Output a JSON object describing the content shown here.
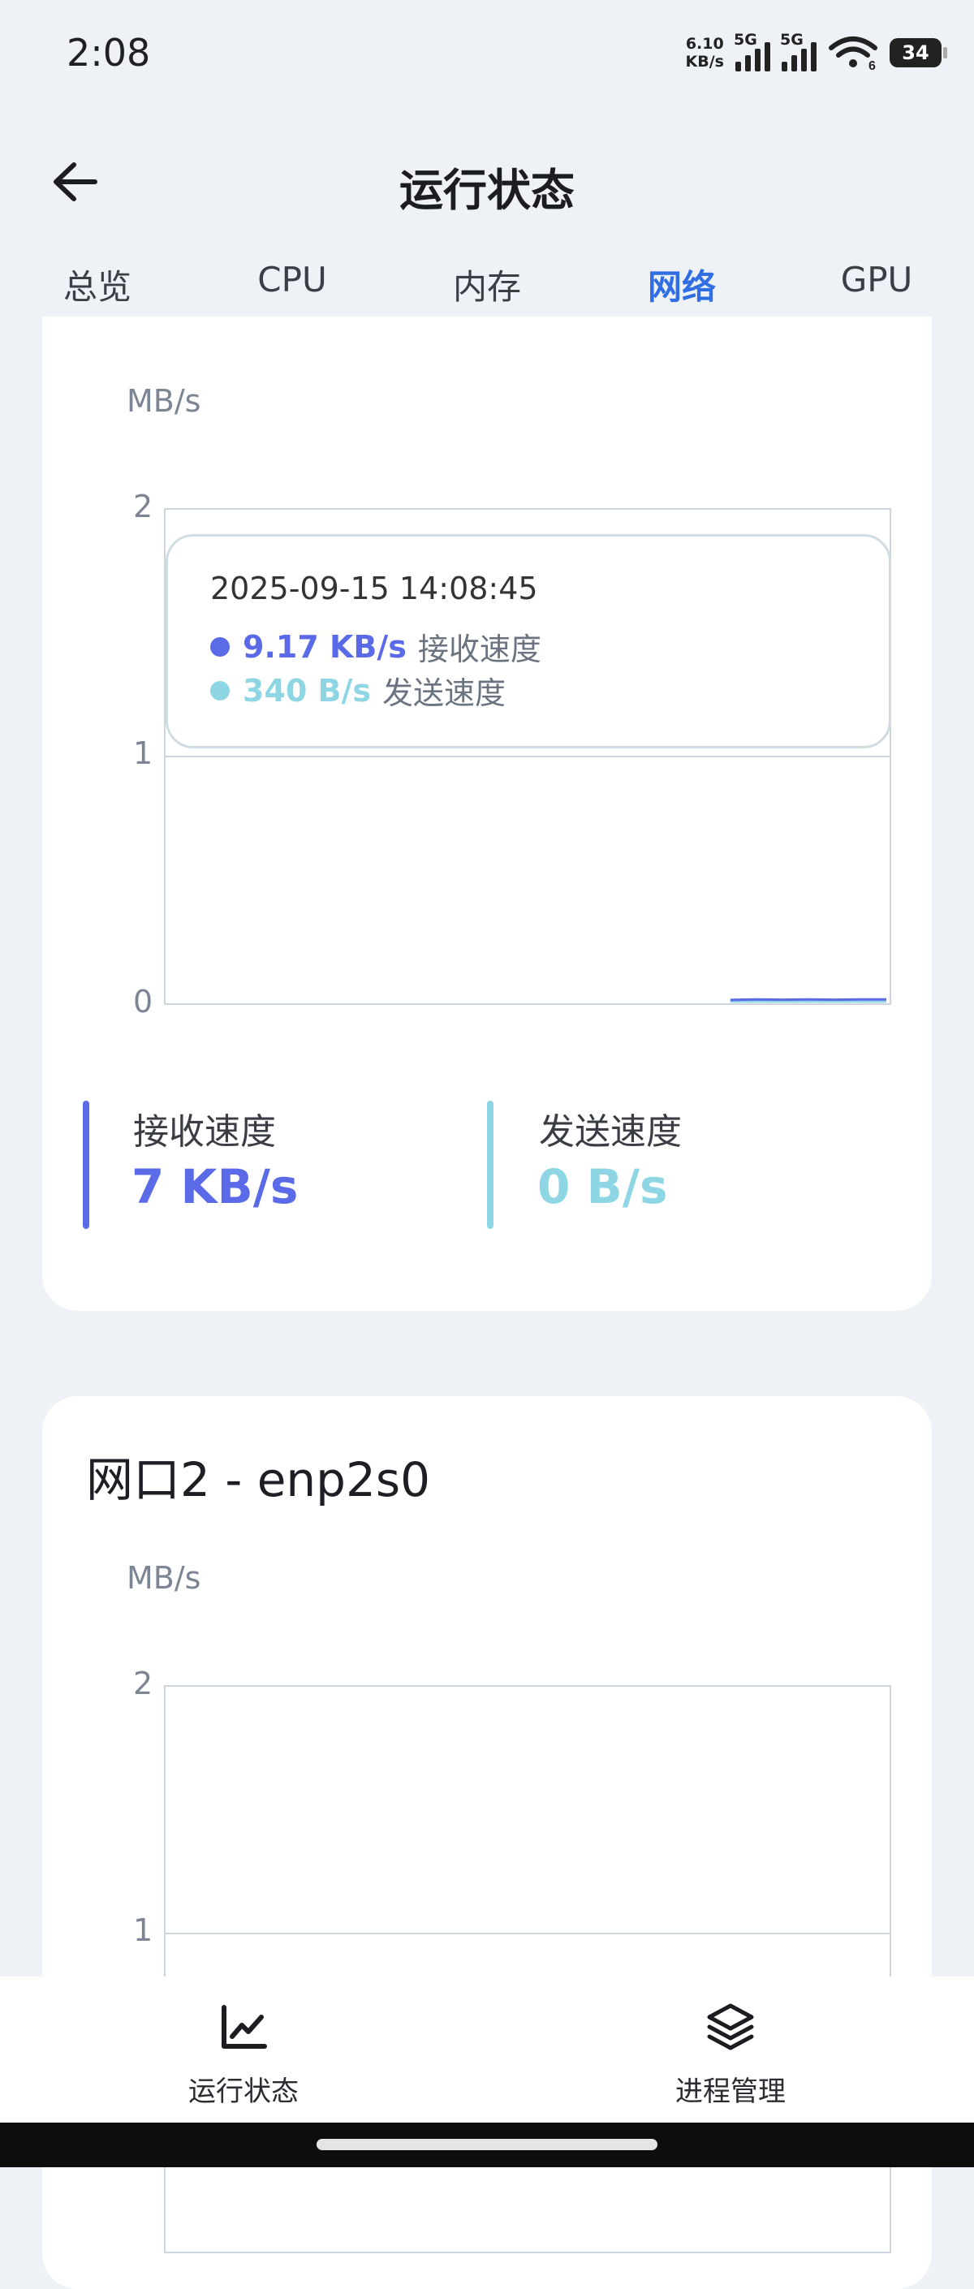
{
  "status_bar": {
    "time": "2:08",
    "net_speed_value": "6.10",
    "net_speed_unit": "KB/s",
    "sim1": "5G",
    "sim2": "5G",
    "wifi_badge": "6",
    "battery": "34"
  },
  "header": {
    "title": "运行状态",
    "back_icon": "arrow-left-icon"
  },
  "tabs": [
    {
      "label": "总览"
    },
    {
      "label": "CPU"
    },
    {
      "label": "内存"
    },
    {
      "label": "网络",
      "active": true
    },
    {
      "label": "GPU"
    }
  ],
  "card1": {
    "unit": "MB/s",
    "y_ticks": [
      "2",
      "1",
      "0"
    ],
    "tooltip": {
      "time": "2025-09-15 14:08:45",
      "rows": [
        {
          "value": "9.17 KB/s",
          "label": "接收速度"
        },
        {
          "value": "340 B/s",
          "label": "发送速度"
        }
      ]
    },
    "stats": {
      "receive_label": "接收速度",
      "receive_value": "7 KB/s",
      "send_label": "发送速度",
      "send_value": "0 B/s"
    }
  },
  "card2": {
    "title": "网口2 - enp2s0",
    "unit": "MB/s",
    "y_ticks": [
      "2",
      "1"
    ]
  },
  "chart_data": {
    "type": "line",
    "ylabel": "MB/s",
    "ylim": [
      0,
      2
    ],
    "series": [
      {
        "name": "接收速度",
        "values": [
          0.007,
          0.009,
          0.008,
          0.009,
          0.008,
          0.009,
          0.009
        ]
      },
      {
        "name": "发送速度",
        "values": [
          0.0003,
          0.0003,
          0.0003,
          0.0003,
          0.0003,
          0.0003,
          0.0003
        ]
      }
    ]
  },
  "colors": {
    "accent": "#2f6fe3",
    "receive": "#5b6be8",
    "send": "#8fd6e4",
    "card_bg": "#ffffff",
    "page_bg": "#eef1f6"
  },
  "bottom_nav": [
    {
      "label": "运行状态",
      "icon": "line-chart-icon"
    },
    {
      "label": "进程管理",
      "icon": "layers-icon"
    }
  ]
}
